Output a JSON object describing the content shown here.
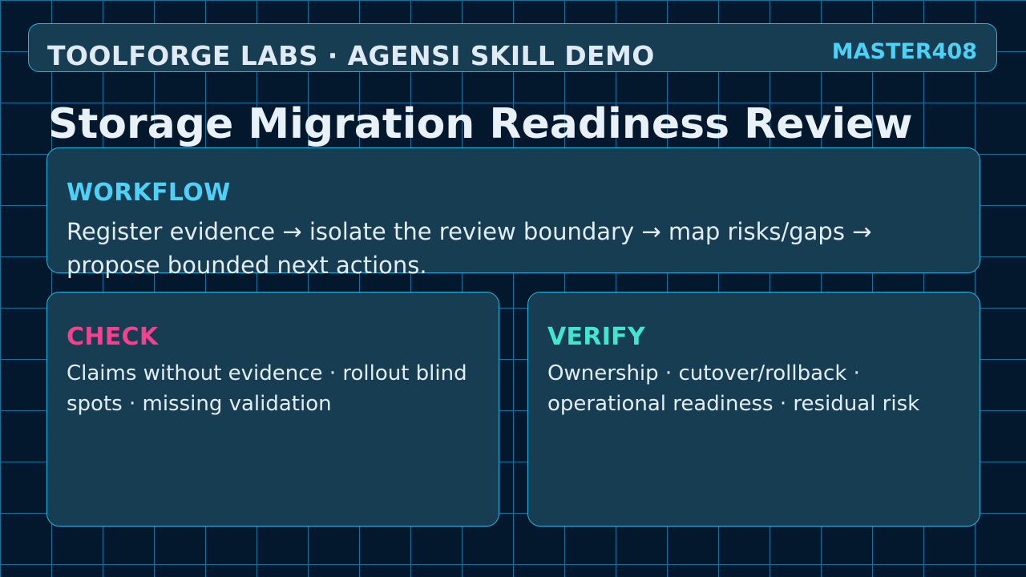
{
  "header": {
    "title": "TOOLFORGE LABS · AGENSI SKILL DEMO",
    "code": "MASTER408"
  },
  "page": {
    "title": "Storage Migration Readiness Review"
  },
  "cards": {
    "workflow": {
      "heading": "WORKFLOW",
      "body": "Register evidence → isolate the review boundary → map risks/gaps → propose bounded next actions."
    },
    "check": {
      "heading": "CHECK",
      "body": "Claims without evidence · rollout blind spots · missing validation"
    },
    "verify": {
      "heading": "VERIFY",
      "body": "Ownership · cutover/rollback · operational readiness · residual risk"
    }
  },
  "colors": {
    "background": "#03182c",
    "grid": "#1d6f9a",
    "panel": "#163d52",
    "border": "#2ab3e0",
    "accent_cyan": "#4fd0f7",
    "accent_pink": "#f2428d",
    "accent_teal": "#42e6cf",
    "text": "#e8f1f8"
  }
}
